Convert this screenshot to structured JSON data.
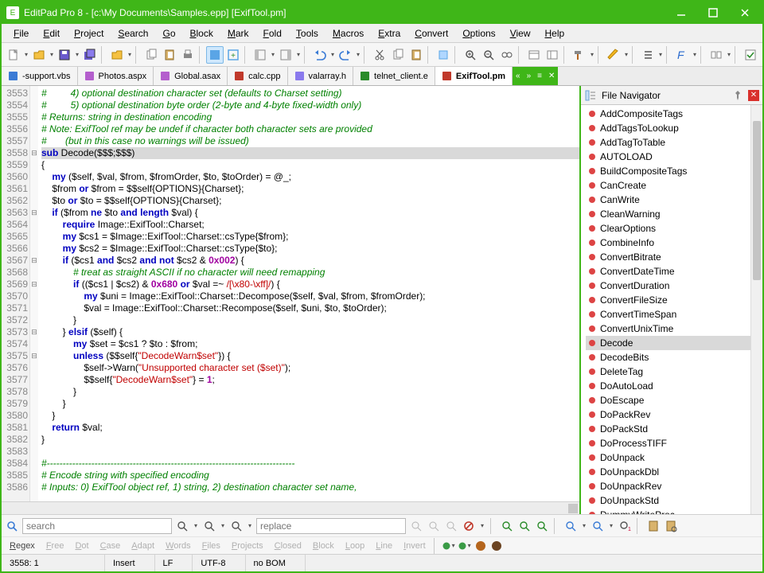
{
  "title": "EditPad Pro 8 - [c:\\My Documents\\Samples.epp] [ExifTool.pm]",
  "menus": [
    "File",
    "Edit",
    "Project",
    "Search",
    "Go",
    "Block",
    "Mark",
    "Fold",
    "Tools",
    "Macros",
    "Extra",
    "Convert",
    "Options",
    "View",
    "Help"
  ],
  "tabs": {
    "list": [
      {
        "label": "-support.vbs"
      },
      {
        "label": "Photos.aspx"
      },
      {
        "label": "Global.asax"
      },
      {
        "label": "calc.cpp"
      },
      {
        "label": "valarray.h"
      },
      {
        "label": "telnet_client.e"
      },
      {
        "label": "ExifTool.pm",
        "active": true
      }
    ]
  },
  "side": {
    "title": "File Navigator",
    "items": [
      "AddCompositeTags",
      "AddTagsToLookup",
      "AddTagToTable",
      "AUTOLOAD",
      "BuildCompositeTags",
      "CanCreate",
      "CanWrite",
      "CleanWarning",
      "ClearOptions",
      "CombineInfo",
      "ConvertBitrate",
      "ConvertDateTime",
      "ConvertDuration",
      "ConvertFileSize",
      "ConvertTimeSpan",
      "ConvertUnixTime",
      "Decode",
      "DecodeBits",
      "DeleteTag",
      "DoAutoLoad",
      "DoEscape",
      "DoPackRev",
      "DoPackStd",
      "DoProcessTIFF",
      "DoUnpack",
      "DoUnpackDbl",
      "DoUnpackRev",
      "DoUnpackStd",
      "DummyWriteProc"
    ],
    "selected": "Decode"
  },
  "chart_data": {
    "lines": [
      {
        "n": 3553,
        "cls": "cm",
        "t": "#         4) optional destination character set (defaults to Charset setting)"
      },
      {
        "n": 3554,
        "cls": "cm",
        "t": "#         5) optional destination byte order (2-byte and 4-byte fixed-width only)"
      },
      {
        "n": 3555,
        "cls": "cm",
        "t": "# Returns: string in destination encoding"
      },
      {
        "n": 3556,
        "cls": "cm",
        "t": "# Note: ExifTool ref may be undef if character both character sets are provided"
      },
      {
        "n": 3557,
        "cls": "cm",
        "t": "#       (but in this case no warnings will be issued)"
      },
      {
        "n": 3558,
        "fold": "[-]",
        "hl": true,
        "html": "<span class='kw'>sub</span> Decode($$$;$$$)"
      },
      {
        "n": 3559,
        "t": "{"
      },
      {
        "n": 3560,
        "html": "    <span class='kw'>my</span> ($self, $val, $from, $fromOrder, $to, $toOrder) = @_;"
      },
      {
        "n": 3561,
        "html": "    $from <span class='kw'>or</span> $from = $$self{OPTIONS}{Charset};"
      },
      {
        "n": 3562,
        "html": "    $to <span class='kw'>or</span> $to = $$self{OPTIONS}{Charset};"
      },
      {
        "n": 3563,
        "fold": "[-]",
        "html": "    <span class='kw'>if</span> ($from <span class='kw'>ne</span> $to <span class='kw'>and length</span> $val) {"
      },
      {
        "n": 3564,
        "html": "        <span class='kw'>require</span> Image::ExifTool::Charset;"
      },
      {
        "n": 3565,
        "html": "        <span class='kw'>my</span> $cs1 = $Image::ExifTool::Charset::csType{$from};"
      },
      {
        "n": 3566,
        "html": "        <span class='kw'>my</span> $cs2 = $Image::ExifTool::Charset::csType{$to};"
      },
      {
        "n": 3567,
        "fold": "[-]",
        "html": "        <span class='kw'>if</span> ($cs1 <span class='kw'>and</span> $cs2 <span class='kw'>and not</span> $cs2 &amp; <span class='pu'>0x002</span>) {"
      },
      {
        "n": 3568,
        "cls": "cm",
        "t": "            # treat as straight ASCII if no character will need remapping"
      },
      {
        "n": 3569,
        "fold": "[-]",
        "html": "            <span class='kw'>if</span> (($cs1 | $cs2) &amp; <span class='pu'>0x680</span> <span class='kw'>or</span> $val =~ <span class='st'>/[\\x80-\\xff]/</span>) {"
      },
      {
        "n": 3570,
        "html": "                <span class='kw'>my</span> $uni = Image::ExifTool::Charset::Decompose($self, $val, $from, $fromOrder);"
      },
      {
        "n": 3571,
        "html": "                $val = Image::ExifTool::Charset::Recompose($self, $uni, $to, $toOrder);"
      },
      {
        "n": 3572,
        "t": "            }"
      },
      {
        "n": 3573,
        "fold": "[-]",
        "html": "        } <span class='kw'>elsif</span> ($self) {"
      },
      {
        "n": 3574,
        "html": "            <span class='kw'>my</span> $set = $cs1 ? $to : $from;"
      },
      {
        "n": 3575,
        "fold": "[-]",
        "html": "            <span class='kw'>unless</span> ($$self{<span class='st'>\"DecodeWarn$set\"</span>}) {"
      },
      {
        "n": 3576,
        "html": "                $self-&gt;Warn(<span class='st'>\"Unsupported character set ($set)\"</span>);"
      },
      {
        "n": 3577,
        "html": "                $$self{<span class='st'>\"DecodeWarn$set\"</span>} = <span class='pu'>1</span>;"
      },
      {
        "n": 3578,
        "t": "            }"
      },
      {
        "n": 3579,
        "t": "        }"
      },
      {
        "n": 3580,
        "t": "    }"
      },
      {
        "n": 3581,
        "html": "    <span class='kw'>return</span> $val;"
      },
      {
        "n": 3582,
        "t": "}"
      },
      {
        "n": 3583,
        "t": ""
      },
      {
        "n": 3584,
        "cls": "cm",
        "t": "#------------------------------------------------------------------------------"
      },
      {
        "n": 3585,
        "cls": "cm",
        "t": "# Encode string with specified encoding"
      },
      {
        "n": 3586,
        "cls": "cm",
        "t": "# Inputs: 0) ExifTool object ref, 1) string, 2) destination character set name,"
      }
    ]
  },
  "search": {
    "search_ph": "search",
    "replace_ph": "replace"
  },
  "opts": [
    "Regex",
    "Free",
    "Dot",
    "Case",
    "Adapt",
    "Words",
    "Files",
    "Projects",
    "Closed",
    "Block",
    "Loop",
    "Line",
    "Invert"
  ],
  "opts_off": [
    "Free",
    "Dot",
    "Case",
    "Adapt",
    "Words",
    "Files",
    "Projects",
    "Closed",
    "Block",
    "Loop",
    "Line",
    "Invert"
  ],
  "status": {
    "pos": "3558: 1",
    "mode": "Insert",
    "eol": "LF",
    "enc": "UTF-8",
    "bom": "no BOM"
  }
}
